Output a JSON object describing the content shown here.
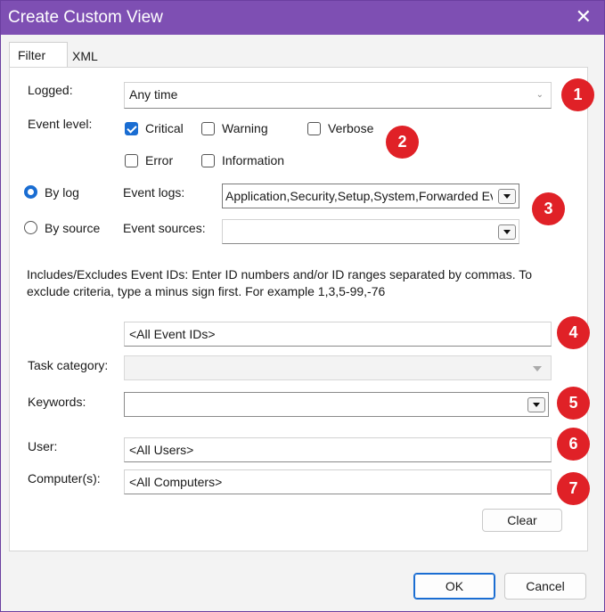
{
  "window": {
    "title": "Create Custom View"
  },
  "tabs": [
    {
      "label": "Filter"
    },
    {
      "label": "XML"
    }
  ],
  "filter": {
    "logged": {
      "label": "Logged:",
      "value": "Any time"
    },
    "event_level": {
      "label": "Event level:",
      "critical": "Critical",
      "warning": "Warning",
      "verbose": "Verbose",
      "error": "Error",
      "information": "Information"
    },
    "by_log": "By log",
    "by_source": "By source",
    "event_logs": {
      "label": "Event logs:",
      "value": "Application,Security,Setup,System,Forwarded Ev"
    },
    "event_sources": {
      "label": "Event sources:",
      "value": ""
    },
    "info_text": "Includes/Excludes Event IDs: Enter ID numbers and/or ID ranges separated by commas. To exclude criteria, type a minus sign first. For example 1,3,5-99,-76",
    "event_ids": {
      "value": "<All Event IDs>"
    },
    "task_category": {
      "label": "Task category:",
      "value": ""
    },
    "keywords": {
      "label": "Keywords:",
      "value": ""
    },
    "user": {
      "label": "User:",
      "value": "<All Users>"
    },
    "computers": {
      "label": "Computer(s):",
      "value": "<All Computers>"
    },
    "clear": "Clear"
  },
  "badges": [
    "1",
    "2",
    "3",
    "4",
    "5",
    "6",
    "7"
  ],
  "footer": {
    "ok": "OK",
    "cancel": "Cancel"
  },
  "colors": {
    "titlebar": "#7e4fb3",
    "badge": "#e02127",
    "accent": "#1a6dd2"
  }
}
